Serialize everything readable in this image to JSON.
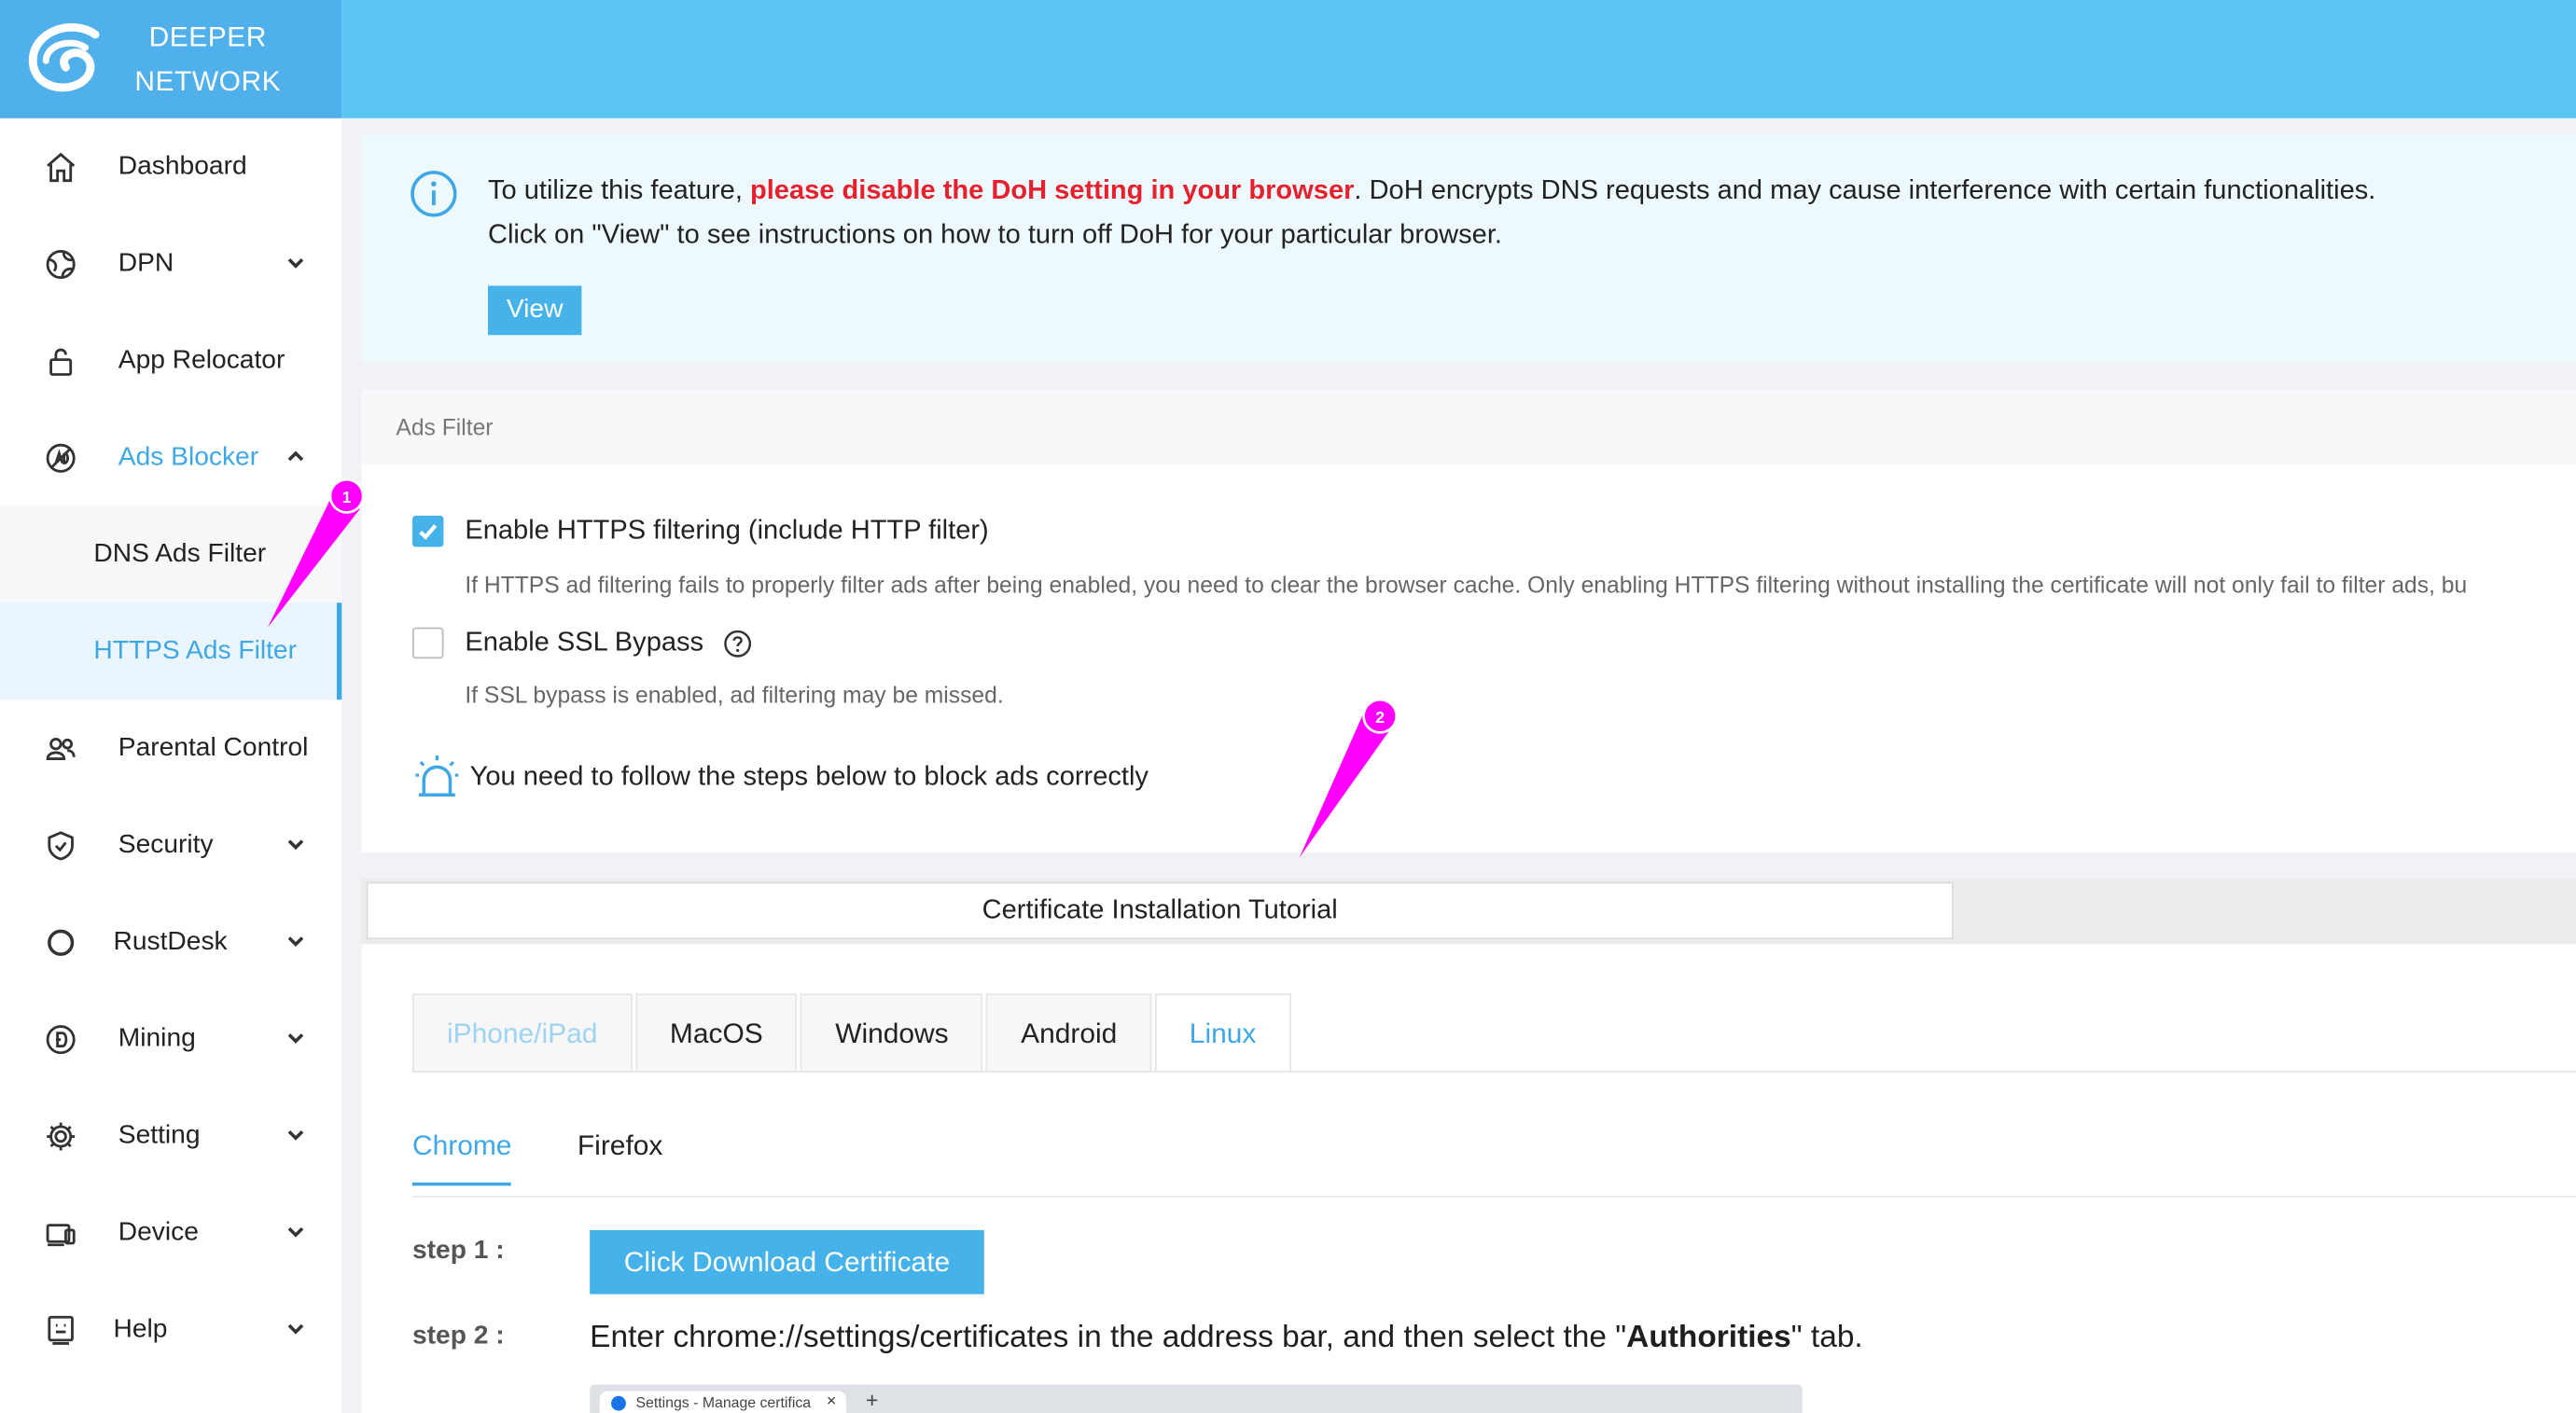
{
  "brand": {
    "line1": "DEEPER",
    "line2": "NETWORK"
  },
  "sidebar": {
    "items": [
      {
        "label": "Dashboard",
        "icon": "home-icon"
      },
      {
        "label": "DPN",
        "icon": "globe-icon"
      },
      {
        "label": "App Relocator",
        "icon": "lock-icon"
      },
      {
        "label": "Ads Blocker",
        "icon": "ads-block-icon"
      },
      {
        "label": "Parental Control",
        "icon": "users-icon"
      },
      {
        "label": "Security",
        "icon": "shield-icon"
      },
      {
        "label": "RustDesk",
        "icon": "circle-icon"
      },
      {
        "label": "Mining",
        "icon": "coin-icon"
      },
      {
        "label": "Setting",
        "icon": "gear-icon"
      },
      {
        "label": "Device",
        "icon": "device-icon"
      },
      {
        "label": "Help",
        "icon": "help-icon"
      }
    ],
    "sub_items": [
      {
        "label": "DNS Ads Filter"
      },
      {
        "label": "HTTPS Ads Filter"
      }
    ]
  },
  "notice": {
    "text_before": "To utilize this feature, ",
    "text_warning": "please disable the DoH setting in your browser",
    "text_after": ". DoH encrypts DNS requests and may cause interference with certain functionalities.",
    "line2": "Click on \"View\" to see instructions on how to turn off DoH for your particular browser.",
    "view_label": "View"
  },
  "ads_filter": {
    "title": "Ads Filter",
    "https_label": "Enable HTTPS filtering (include HTTP filter)",
    "https_checked": true,
    "https_hint": "If HTTPS ad filtering fails to properly filter ads after being enabled, you need to clear the browser cache. Only enabling HTTPS filtering without installing the certificate will not only fail to filter ads, bu",
    "ssl_label": "Enable SSL Bypass",
    "ssl_checked": false,
    "ssl_hint": "If SSL bypass is enabled, ad filtering may be missed.",
    "steps_notice": "You need to follow the steps below to block ads correctly"
  },
  "tutorial": {
    "tab_label": "Certificate Installation Tutorial",
    "os_tabs": [
      "iPhone/iPad",
      "MacOS",
      "Windows",
      "Android",
      "Linux"
    ],
    "active_os": "Linux",
    "browser_tabs": [
      "Chrome",
      "Firefox"
    ],
    "active_browser": "Chrome",
    "step1_label": "step 1 :",
    "download_label": "Click Download Certificate",
    "step2_label": "step 2 :",
    "step2_before": "Enter chrome://settings/certificates in the address bar, and then select the \"",
    "step2_bold": "Authorities",
    "step2_after": "\" tab.",
    "mini_tab_title": "Settings - Manage certifica",
    "mini_close": "×",
    "mini_plus": "+"
  },
  "annotations": {
    "marker1": "1",
    "marker2": "2"
  },
  "colors": {
    "accent": "#3ea8e6",
    "header": "#5cc6f2",
    "warning": "#e5212d",
    "marker": "#ff00ff"
  }
}
